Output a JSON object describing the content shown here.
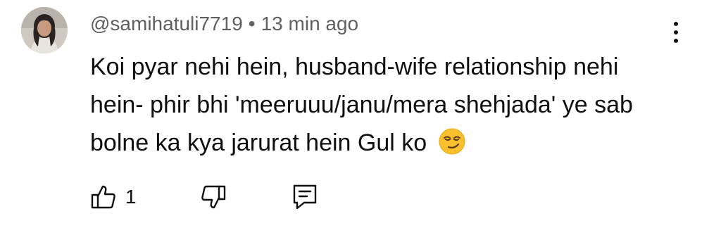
{
  "comment": {
    "author": "@samihatuli7719",
    "separator": "•",
    "timestamp": "13 min ago",
    "text": "Koi pyar nehi hein, husband-wife relationship nehi hein- phir bhi 'meeruuu/janu/mera shehjada' ye sab bolne ka kya jarurat hein Gul ko",
    "emoji_name": "smirking-face-emoji",
    "like_count": "1"
  },
  "icons": {
    "like": "thumbs-up-icon",
    "dislike": "thumbs-down-icon",
    "reply": "reply-comment-icon",
    "more": "more-vertical-icon"
  },
  "colors": {
    "meta_text": "#606060",
    "body_text": "#0f0f0f",
    "emoji_face": "#fbc02d"
  }
}
